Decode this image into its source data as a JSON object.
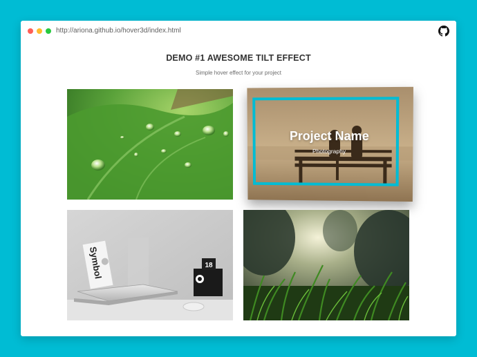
{
  "browser": {
    "url": "http://ariona.github.io/hover3d/index.html",
    "dot_colors": [
      "#FF5F56",
      "#FFBD2E",
      "#27C93F"
    ],
    "github_icon": "github-icon"
  },
  "page": {
    "title": "DEMO #1 AWESOME TILT EFFECT",
    "subtitle": "Simple hover effect for your project"
  },
  "gallery": {
    "items": [
      {
        "image": "green-leaf-water-drops"
      },
      {
        "image": "couple-on-bench-sunset",
        "project_name": "Project Name",
        "category": "Photography"
      },
      {
        "image": "laptop-desk-symbol-book",
        "book_text": "Symbol",
        "calendar_number": "18"
      },
      {
        "image": "grass-and-trees-sunlight"
      }
    ],
    "accent": "#00BCD4"
  }
}
